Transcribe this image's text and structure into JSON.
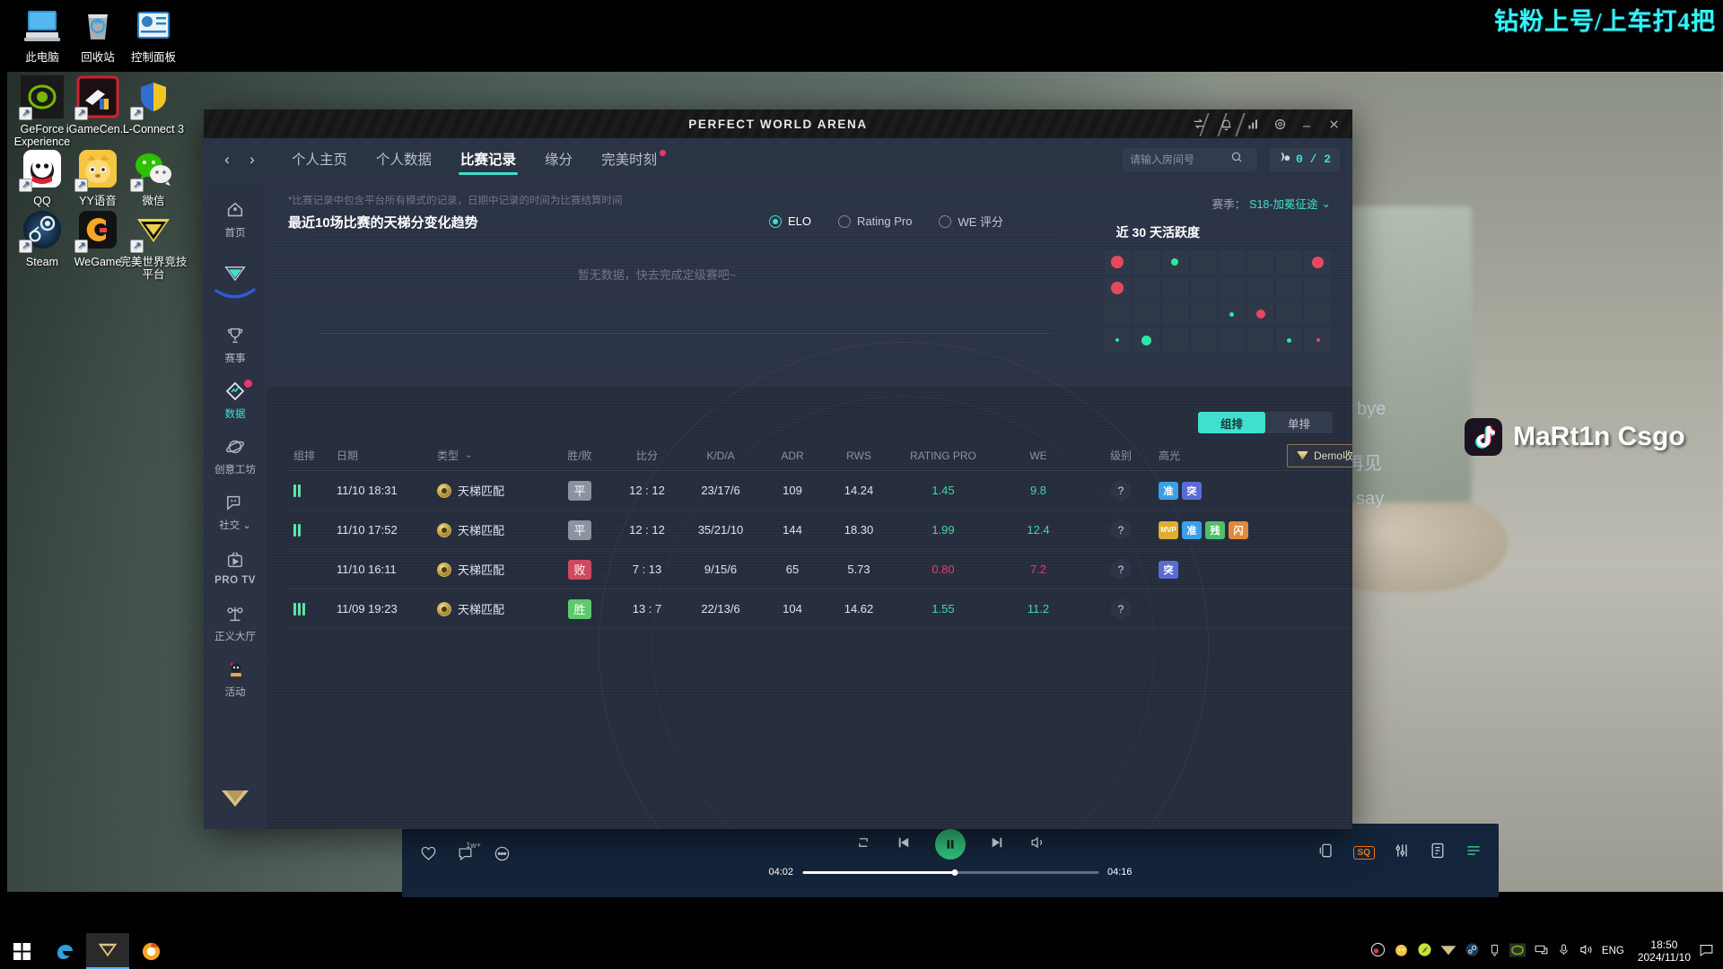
{
  "desktop": {
    "icons": [
      {
        "label": "此电脑",
        "icon": "computer-icon",
        "shortcut": false
      },
      {
        "label": "回收站",
        "icon": "recycle-bin-icon",
        "shortcut": false
      },
      {
        "label": "控制面板",
        "icon": "control-panel-icon",
        "shortcut": false
      },
      {
        "label": "GeForce Experience",
        "icon": "geforce-icon",
        "shortcut": true
      },
      {
        "label": "iGameCen...",
        "icon": "igame-center-icon",
        "shortcut": true
      },
      {
        "label": "L-Connect 3",
        "icon": "l-connect-icon",
        "shortcut": true
      },
      {
        "label": "QQ",
        "icon": "qq-icon",
        "shortcut": true
      },
      {
        "label": "YY语音",
        "icon": "yy-voice-icon",
        "shortcut": true
      },
      {
        "label": "微信",
        "icon": "wechat-icon",
        "shortcut": true
      },
      {
        "label": "Steam",
        "icon": "steam-icon",
        "shortcut": true
      },
      {
        "label": "WeGame",
        "icon": "wegame-icon",
        "shortcut": true
      },
      {
        "label": "完美世界竞技平台",
        "icon": "perfect-world-arena-icon",
        "shortcut": true
      }
    ]
  },
  "stream": {
    "headline": "钻粉上号/上车打4把",
    "tiktok_name": "MaRt1n Csgo",
    "chat": [
      "bye",
      "再见",
      "t say"
    ],
    "headline_color": "#35f6ef"
  },
  "music": {
    "current_time": "04:02",
    "total_time": "04:16",
    "quality_badge": "SQ",
    "like_count": "1w+"
  },
  "window": {
    "title": "PERFECT WORLD ARENA",
    "controls": [
      "share-icon",
      "bell-icon",
      "signal-icon",
      "settings-icon",
      "minimize-icon",
      "close-icon"
    ]
  },
  "nav": {
    "back": "‹",
    "forward": "›",
    "tabs": [
      {
        "label": "个人主页",
        "active": false
      },
      {
        "label": "个人数据",
        "active": false
      },
      {
        "label": "比赛记录",
        "active": true
      },
      {
        "label": "缘分",
        "active": false
      },
      {
        "label": "完美时刻",
        "active": false,
        "dot": true
      }
    ],
    "search_placeholder": "请输入房间号",
    "search_value": "",
    "coins": "0 / 2"
  },
  "sidebar": {
    "items": [
      {
        "label": "首页",
        "icon": "home-icon",
        "active": false
      },
      {
        "label": "",
        "icon": "game-logo-icon",
        "active": false
      },
      {
        "label": "赛事",
        "icon": "trophy-icon",
        "active": false
      },
      {
        "label": "数据",
        "icon": "data-diamond-icon",
        "active": true,
        "badge": true
      },
      {
        "label": "创意工坊",
        "icon": "workshop-planet-icon",
        "active": false
      },
      {
        "label": "社交",
        "icon": "social-chat-icon",
        "active": false,
        "chevron": true
      },
      {
        "label": "PRO TV",
        "icon": "pro-tv-icon",
        "active": false
      },
      {
        "label": "正义大厅",
        "icon": "justice-scale-icon",
        "active": false
      },
      {
        "label": "活动",
        "icon": "activity-mascot-icon",
        "active": false
      }
    ],
    "bottom_icon": "rank-badge-icon"
  },
  "trend": {
    "note": "*比赛记录中包含平台所有模式的记录，日期中记录的时间为比赛结算时间",
    "title": "最近10场比赛的天梯分变化趋势",
    "empty_message": "暂无数据，快去完成定级赛吧~",
    "radios": [
      {
        "label": "ELO",
        "selected": true
      },
      {
        "label": "Rating Pro",
        "selected": false
      },
      {
        "label": "WE 评分",
        "selected": false
      }
    ]
  },
  "season": {
    "label": "赛季：",
    "value": "S18-加冕征途"
  },
  "activity": {
    "title": "近 30 天活跃度",
    "columns": 8,
    "rows": 4,
    "cells": [
      [
        {
          "c": "red",
          "s": 14
        },
        {
          "c": "none"
        },
        {
          "c": "green",
          "s": 8
        },
        {
          "c": "none"
        },
        {
          "c": "none"
        },
        {
          "c": "none"
        },
        {
          "c": "none"
        },
        {
          "c": "red",
          "s": 13
        }
      ],
      [
        {
          "c": "red",
          "s": 14
        },
        {
          "c": "none"
        },
        {
          "c": "none"
        },
        {
          "c": "none"
        },
        {
          "c": "none"
        },
        {
          "c": "none"
        },
        {
          "c": "none"
        },
        {
          "c": "none"
        }
      ],
      [
        {
          "c": "none"
        },
        {
          "c": "none"
        },
        {
          "c": "none"
        },
        {
          "c": "none"
        },
        {
          "c": "green",
          "s": 5
        },
        {
          "c": "red",
          "s": 10
        },
        {
          "c": "none"
        },
        {
          "c": "none"
        }
      ],
      [
        {
          "c": "green",
          "s": 4
        },
        {
          "c": "green",
          "s": 11
        },
        {
          "c": "none"
        },
        {
          "c": "none"
        },
        {
          "c": "none"
        },
        {
          "c": "none"
        },
        {
          "c": "green",
          "s": 5
        },
        {
          "c": "red",
          "s": 4
        }
      ]
    ],
    "color_red": "#e8485f",
    "color_green": "#2ee6a0"
  },
  "mode_toggle": {
    "options": [
      "组排",
      "单排"
    ],
    "selected": "组排"
  },
  "table": {
    "headers": [
      "组排",
      "日期",
      "类型",
      "胜/败",
      "比分",
      "K/D/A",
      "ADR",
      "RWS",
      "RATING PRO",
      "WE",
      "级别",
      "高光"
    ],
    "type_sort_icon": "chevron-down-icon",
    "demo_button": "Demo收藏",
    "rows": [
      {
        "rank_bars": 2,
        "date": "11/10 18:31",
        "type": "天梯匹配",
        "result": "平",
        "result_kind": "draw",
        "score": "12 : 12",
        "kda": "23/17/6",
        "adr": "109",
        "rws": "14.24",
        "rating_pro": "1.45",
        "rating_kind": "good",
        "we": "9.8",
        "we_kind": "good",
        "level": "?",
        "highlights": [
          {
            "t": "准",
            "c": "#3d9ee8"
          },
          {
            "t": "突",
            "c": "#5b6bd6"
          }
        ]
      },
      {
        "rank_bars": 2,
        "date": "11/10 17:52",
        "type": "天梯匹配",
        "result": "平",
        "result_kind": "draw",
        "score": "12 : 12",
        "kda": "35/21/10",
        "adr": "144",
        "rws": "18.30",
        "rating_pro": "1.99",
        "rating_kind": "good",
        "we": "12.4",
        "we_kind": "good",
        "level": "?",
        "highlights": [
          {
            "t": "MVP",
            "c": "#e0ac33"
          },
          {
            "t": "准",
            "c": "#3d9ee8"
          },
          {
            "t": "残",
            "c": "#4fbf6d"
          },
          {
            "t": "闪",
            "c": "#e08a3a"
          }
        ]
      },
      {
        "rank_bars": 0,
        "date": "11/10 16:11",
        "type": "天梯匹配",
        "result": "败",
        "result_kind": "lose",
        "score": "7 : 13",
        "kda": "9/15/6",
        "adr": "65",
        "rws": "5.73",
        "rating_pro": "0.80",
        "rating_kind": "bad",
        "we": "7.2",
        "we_kind": "bad",
        "level": "?",
        "highlights": [
          {
            "t": "突",
            "c": "#5b6bd6"
          }
        ]
      },
      {
        "rank_bars": 3,
        "date": "11/09 19:23",
        "type": "天梯匹配",
        "result": "胜",
        "result_kind": "win",
        "score": "13 : 7",
        "kda": "22/13/6",
        "adr": "104",
        "rws": "14.62",
        "rating_pro": "1.55",
        "rating_kind": "good",
        "we": "11.2",
        "we_kind": "good",
        "level": "?",
        "highlights": []
      }
    ]
  },
  "taskbar": {
    "time": "18:50",
    "date": "2024/11/10",
    "language": "ENG",
    "tray_icons": [
      "obs-icon",
      "yy-icon",
      "software-icon",
      "perfect-world-icon",
      "steam-icon",
      "usb-icon",
      "nvidia-icon",
      "network-icon",
      "mic-icon",
      "volume-icon"
    ],
    "pinned": [
      "start-icon",
      "edge-icon",
      "arena-icon",
      "browser-icon"
    ]
  },
  "colors": {
    "accent": "#3fe0d0",
    "win": "#5ce66a",
    "lose": "#d94a5e",
    "draw": "#8b939f"
  }
}
